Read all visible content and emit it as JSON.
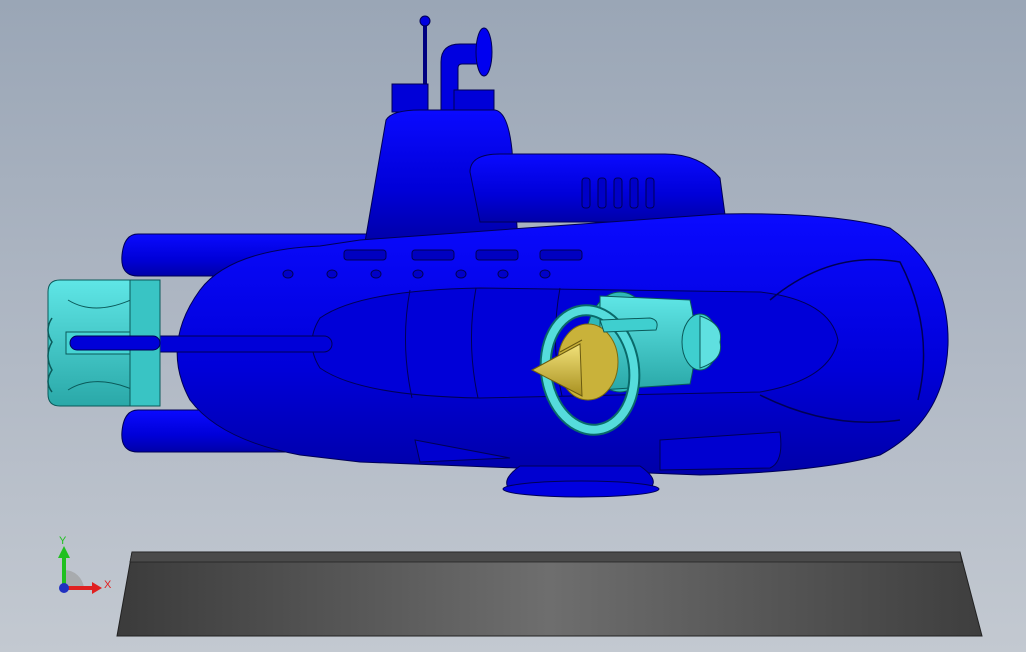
{
  "viewport": {
    "background_top": "#9aa6b6",
    "background_bottom": "#c3c9d1"
  },
  "model": {
    "hull_color": "#0000e0",
    "hull_edge_color": "#000055",
    "accent_color": "#33cccc",
    "cone_color": "#d9c23a",
    "stand_color": "#5a5a5a"
  },
  "triad": {
    "x_label": "X",
    "y_label": "Y",
    "x_color": "#e02020",
    "y_color": "#20c020",
    "z_color": "#2030c0"
  }
}
